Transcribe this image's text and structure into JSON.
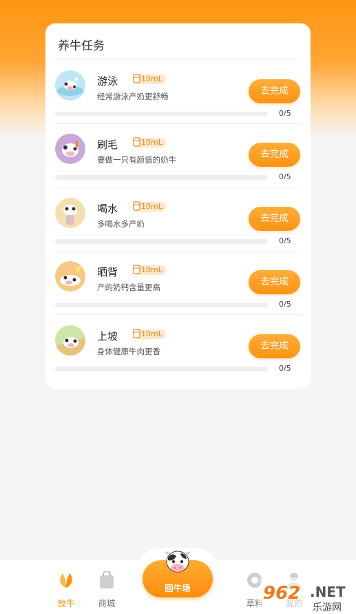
{
  "card": {
    "title": "养牛任务"
  },
  "tasks": [
    {
      "name": "游泳",
      "reward": "10mL",
      "desc": "经常游泳产奶更舒畅",
      "action": "去完成",
      "progress": "0/5",
      "done": 0,
      "total": 5,
      "avatar_bg": "#bfe6f5"
    },
    {
      "name": "刷毛",
      "reward": "10mL",
      "desc": "要做一只有颜值的奶牛",
      "action": "去完成",
      "progress": "0/5",
      "done": 0,
      "total": 5,
      "avatar_bg": "#c8a8d8"
    },
    {
      "name": "喝水",
      "reward": "10mL",
      "desc": "多喝水多产奶",
      "action": "去完成",
      "progress": "0/5",
      "done": 0,
      "total": 5,
      "avatar_bg": "#f4dfb0"
    },
    {
      "name": "晒背",
      "reward": "10mL",
      "desc": "产的奶钙含量更高",
      "action": "去完成",
      "progress": "0/5",
      "done": 0,
      "total": 5,
      "avatar_bg": "#f6c884"
    },
    {
      "name": "上坡",
      "reward": "10mL",
      "desc": "身体健康牛肉更香",
      "action": "去完成",
      "progress": "0/5",
      "done": 0,
      "total": 5,
      "avatar_bg": "#cde6a8"
    }
  ],
  "tabbar": {
    "tabs": [
      {
        "label": "放牛",
        "icon": "leaf-icon",
        "active": true
      },
      {
        "label": "商城",
        "icon": "shopping-bag-icon",
        "active": false
      },
      {
        "label": "草料",
        "icon": "feed-icon",
        "active": false
      },
      {
        "label": "我的",
        "icon": "user-icon",
        "active": false
      }
    ],
    "center": {
      "label": "回牛场",
      "icon": "cow-icon"
    }
  },
  "watermark": {
    "brand": "962",
    "suffix": ".NET",
    "sub": "乐游网"
  },
  "colors": {
    "accent": "#ff9312",
    "accent_light": "#ffae3a",
    "badge_bg": "#fde8cc",
    "text": "#333333"
  }
}
